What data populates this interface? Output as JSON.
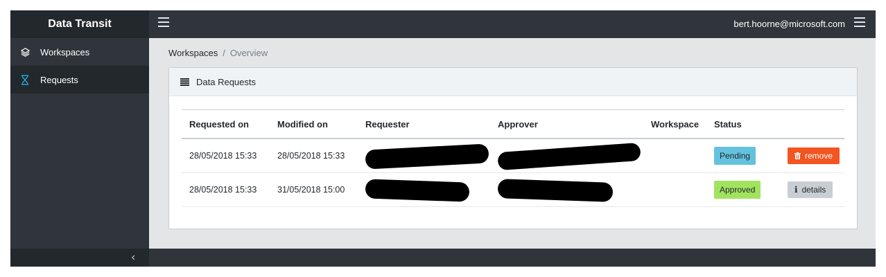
{
  "header": {
    "brand": "Data Transit",
    "user_email": "bert.hoorne@microsoft.com"
  },
  "sidebar": {
    "items": [
      {
        "label": "Workspaces",
        "icon": "layers-icon"
      },
      {
        "label": "Requests",
        "icon": "hourglass-icon"
      }
    ],
    "collapse_icon": "chevron-left-icon"
  },
  "breadcrumb": {
    "root": "Workspaces",
    "separator": "/",
    "current": "Overview"
  },
  "card": {
    "title": "Data Requests"
  },
  "table": {
    "columns": [
      "Requested on",
      "Modified on",
      "Requester",
      "Approver",
      "Workspace",
      "Status",
      ""
    ],
    "rows": [
      {
        "requested_on": "28/05/2018 15:33",
        "modified_on": "28/05/2018 15:33",
        "requester": "[redacted]",
        "approver": "[redacted]",
        "workspace": "",
        "status": "Pending",
        "action": "remove"
      },
      {
        "requested_on": "28/05/2018 15:33",
        "modified_on": "31/05/2018 15:00",
        "requester": "[redacted]",
        "approver": "[redacted]",
        "workspace": "",
        "status": "Approved",
        "action": "details"
      }
    ]
  },
  "colors": {
    "topbar": "#2f353a",
    "brand_bg": "#23282c",
    "pending": "#63c2de",
    "approved": "#a1e35f",
    "remove": "#f25521"
  }
}
